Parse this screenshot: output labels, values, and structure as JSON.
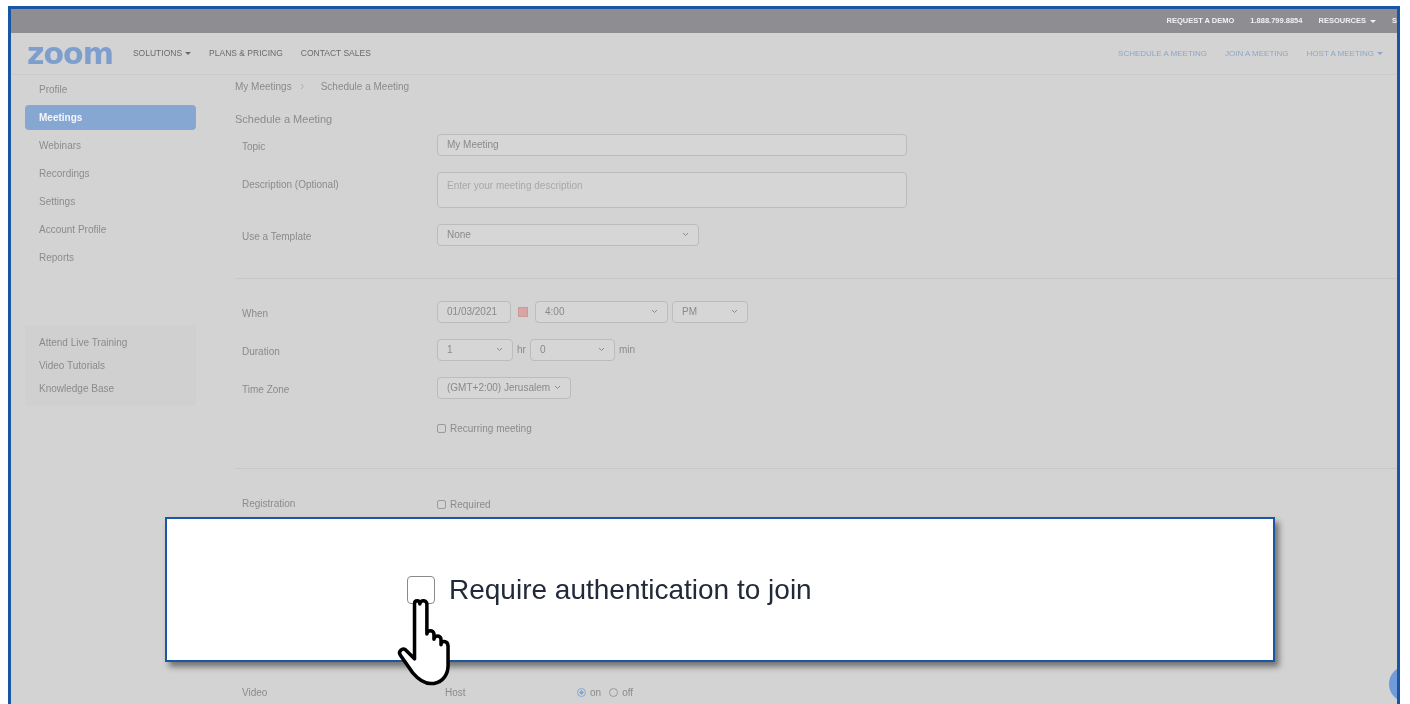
{
  "top_bar": {
    "links": [
      {
        "label": "REQUEST A DEMO",
        "dropdown": false
      },
      {
        "label": "1.888.799.8854",
        "dropdown": false
      },
      {
        "label": "RESOURCES",
        "dropdown": true
      },
      {
        "label": "S",
        "dropdown": false
      }
    ]
  },
  "nav": {
    "logo": "zoom",
    "left_links": [
      {
        "label": "SOLUTIONS",
        "dropdown": true
      },
      {
        "label": "PLANS & PRICING",
        "dropdown": false
      },
      {
        "label": "CONTACT SALES",
        "dropdown": false
      }
    ],
    "right_links": [
      {
        "label": "SCHEDULE A MEETING",
        "dropdown": false
      },
      {
        "label": "JOIN A MEETING",
        "dropdown": false
      },
      {
        "label": "HOST A MEETING",
        "dropdown": true
      }
    ]
  },
  "sidebar": {
    "items": [
      {
        "label": "Profile",
        "selected": false
      },
      {
        "label": "Meetings",
        "selected": true
      },
      {
        "label": "Webinars",
        "selected": false
      },
      {
        "label": "Recordings",
        "selected": false
      },
      {
        "label": "Settings",
        "selected": false
      },
      {
        "label": "Account Profile",
        "selected": false
      },
      {
        "label": "Reports",
        "selected": false
      }
    ],
    "help_links": [
      "Attend Live Training",
      "Video Tutorials",
      "Knowledge Base"
    ]
  },
  "breadcrumb": [
    "My Meetings",
    "Schedule a Meeting"
  ],
  "page_title": "Schedule a Meeting",
  "sections": [
    [
      {
        "label": "Topic",
        "kind": "text",
        "value": "My Meeting"
      },
      {
        "label": "Description (Optional)",
        "kind": "textarea",
        "placeholder": "Enter your meeting description"
      },
      {
        "label": "Use a Template",
        "kind": "select",
        "value": "None"
      }
    ],
    [
      {
        "label": "When",
        "kind": "datetime",
        "date": "01/03/2021",
        "time": "4:00",
        "ampm": "PM"
      },
      {
        "label": "Duration",
        "kind": "duration",
        "hours": "1",
        "hours_unit": "hr",
        "minutes": "0",
        "minutes_unit": "min"
      },
      {
        "label": "Time Zone",
        "kind": "select",
        "value": "(GMT+2:00) Jerusalem"
      },
      {
        "kind": "checkbox",
        "text": "Recurring meeting",
        "checked": false
      }
    ],
    [
      {
        "label": "Registration",
        "kind": "checkbox",
        "text": "Required",
        "checked": false
      }
    ]
  ],
  "video_row": {
    "label": "Video",
    "host_label": "Host",
    "options": [
      {
        "label": "on",
        "selected": true
      },
      {
        "label": "off",
        "selected": false
      }
    ]
  },
  "callout": {
    "text": "Require authentication to join",
    "checked": false
  }
}
